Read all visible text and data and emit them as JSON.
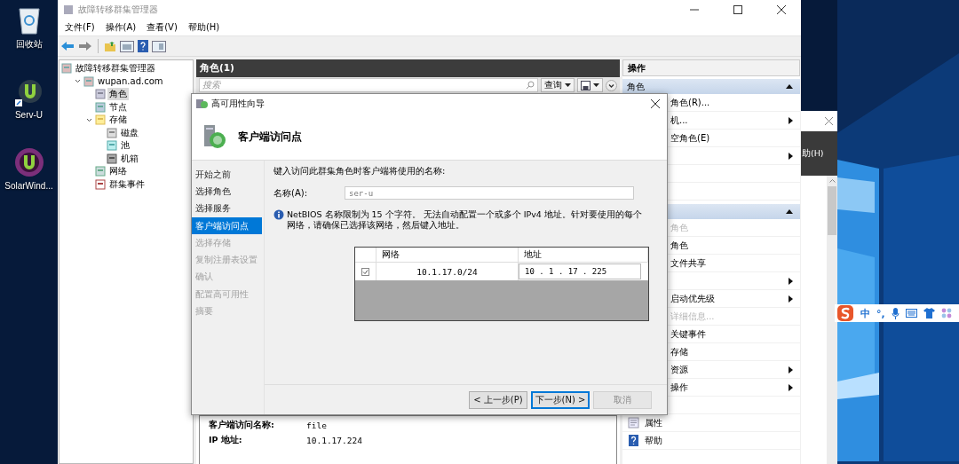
{
  "desktop_icons": [
    {
      "label": "回收站",
      "kind": "recycle"
    },
    {
      "label": "Serv-U",
      "kind": "servu"
    },
    {
      "label": "SolarWind...",
      "kind": "solarwinds"
    }
  ],
  "main_window": {
    "title": "故障转移群集管理器",
    "menu": [
      "文件(F)",
      "操作(A)",
      "查看(V)",
      "帮助(H)"
    ],
    "tree": {
      "root": "故障转移群集管理器",
      "items": [
        {
          "label": "wupan.ad.com",
          "kind": "cluster",
          "expanded": true,
          "selected": false,
          "children": [
            {
              "label": "角色",
              "kind": "roles",
              "selected": true
            },
            {
              "label": "节点",
              "kind": "nodes",
              "selected": false
            },
            {
              "label": "存储",
              "kind": "storage",
              "expanded": true,
              "selected": false,
              "children": [
                {
                  "label": "磁盘",
                  "kind": "disk",
                  "selected": false
                },
                {
                  "label": "池",
                  "kind": "pool",
                  "selected": false
                },
                {
                  "label": "机箱",
                  "kind": "enclosure",
                  "selected": false
                }
              ]
            },
            {
              "label": "网络",
              "kind": "network",
              "selected": false
            },
            {
              "label": "群集事件",
              "kind": "events",
              "selected": false
            }
          ]
        }
      ]
    },
    "center": {
      "title": "角色(1)",
      "search_placeholder": "搜索",
      "query_button": "查询",
      "details": [
        {
          "label": "客户端访问名称:",
          "value": "file"
        },
        {
          "label": "IP 地址:",
          "value": "10.1.17.224"
        }
      ]
    },
    "actions": {
      "title": "操作",
      "sections": [
        {
          "title": "角色",
          "expanded": true,
          "items": [
            {
              "label": "角色(R)...",
              "submenu": false,
              "disabled": false
            },
            {
              "label": "机...",
              "submenu": true,
              "disabled": false
            },
            {
              "label": "空角色(E)",
              "submenu": false,
              "disabled": false
            },
            {
              "submenu": true
            },
            {
              "submenu": false
            },
            {
              "submenu": false
            }
          ]
        },
        {
          "expanded": true,
          "items": [
            {
              "label": "角色",
              "submenu": false,
              "disabled": true
            },
            {
              "label": "角色",
              "submenu": false,
              "disabled": false
            },
            {
              "label": "文件共享",
              "submenu": false,
              "disabled": false
            },
            {
              "submenu": true
            },
            {
              "label": "启动优先级",
              "submenu": true,
              "disabled": false
            },
            {
              "label": "详细信息...",
              "submenu": false,
              "disabled": true
            },
            {
              "label": "关键事件",
              "submenu": false,
              "disabled": false
            },
            {
              "label": "存储",
              "submenu": false,
              "disabled": false
            },
            {
              "label": "资源",
              "submenu": true,
              "disabled": false
            },
            {
              "label": "操作",
              "submenu": true,
              "disabled": false
            },
            {
              "submenu": false
            },
            {
              "label": "属性",
              "kind": "properties",
              "submenu": false,
              "disabled": false
            },
            {
              "label": "帮助",
              "kind": "help",
              "submenu": false,
              "disabled": false
            }
          ]
        }
      ]
    }
  },
  "dialog": {
    "title": "高可用性向导",
    "heading": "客户端访问点",
    "steps": [
      {
        "label": "开始之前",
        "selected": false,
        "disabled": false
      },
      {
        "label": "选择角色",
        "selected": false,
        "disabled": false
      },
      {
        "label": "选择服务",
        "selected": false,
        "disabled": false
      },
      {
        "label": "客户端访问点",
        "selected": true,
        "disabled": false
      },
      {
        "label": "选择存储",
        "selected": false,
        "disabled": true
      },
      {
        "label": "复制注册表设置",
        "selected": false,
        "disabled": true
      },
      {
        "label": "确认",
        "selected": false,
        "disabled": true
      },
      {
        "label": "配置高可用性",
        "selected": false,
        "disabled": true
      },
      {
        "label": "摘要",
        "selected": false,
        "disabled": true
      }
    ],
    "prompt": "键入访问此群集角色时客户端将使用的名称:",
    "name_label": "名称(A):",
    "name_value": "ser-u",
    "info": "NetBIOS 名称限制为 15 个字符。 无法自动配置一个或多个 IPv4 地址。针对要使用的每个网络，请确保已选择该网络，然后键入地址。",
    "table": {
      "columns": [
        "网络",
        "地址"
      ],
      "rows": [
        {
          "checked": true,
          "network": "10.1.17.0/24",
          "address": "10 . 1 . 17 . 225"
        }
      ]
    },
    "buttons": [
      {
        "label": "< 上一步(P)",
        "focused": false,
        "disabled": false
      },
      {
        "label": "下一步(N) >",
        "focused": true,
        "disabled": false
      },
      {
        "label": "取消",
        "focused": false,
        "disabled": true
      }
    ]
  },
  "second_window": {
    "menu_fragment": "助(H)"
  },
  "ime_bar": {
    "mode": "中",
    "punctuation": "°,"
  }
}
